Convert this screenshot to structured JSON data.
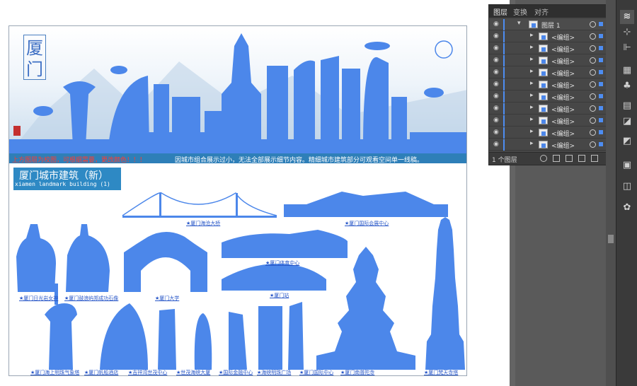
{
  "artboard": {
    "logo_text": "厦门",
    "ribbon_warning": "上方图层为校图，可根据需要，更改颜色！！！",
    "ribbon_note": "因城市组合展示过小，无法全部展示细节内容。精细城市建筑部分可观看空间单一线稿。",
    "section_title_cn": "厦门城市建筑（新）",
    "section_title_en": "xiamen landmark building (1)",
    "building_color": "#4c87ea",
    "labels": {
      "haicang_bridge": "★厦门海沧大桥",
      "conference_center": "★厦门国际会展中心",
      "gulangyu_statue": "★厦门日光岩女神",
      "zheng_chenggong": "★厦门鼓浪屿郑成功石像",
      "xiamen_university": "★厦门大学",
      "sports_center": "★厦门体育中心",
      "xiamen_station": "★厦门站",
      "tower_meteo": "★厦门海上明珠气象塔",
      "sail_hotel": "★厦门帆船酒店",
      "shimao": "★吉祥湾世茂中心",
      "world_trade": "★世茂海峡大厦",
      "financial": "★国际金融中心",
      "pearl_plaza": "★海峡明珠广场",
      "intl_center": "★厦门国际中心",
      "pagoda_temple": "★厦门南普陀寺",
      "tall_pagoda": "★厦门梵天寺塔"
    }
  },
  "layers_panel": {
    "tabs": [
      "图层",
      "变换",
      "对齐"
    ],
    "menu_icon": "»",
    "top_layer": "图层 1",
    "groups": [
      "<编组>",
      "<编组>",
      "<编组>",
      "<编组>",
      "<编组>",
      "<编组>",
      "<编组>",
      "<编组>",
      "<编组>",
      "<编组>"
    ],
    "footer_text": "1 个图层"
  },
  "toolbar": {
    "tools": [
      "layers-icon",
      "transform-icon",
      "align-icon",
      "grid-icon",
      "symbol-icon",
      "artboard-icon",
      "pathfinder-icon",
      "gradient-icon",
      "appearance-icon",
      "palette-icon"
    ]
  }
}
